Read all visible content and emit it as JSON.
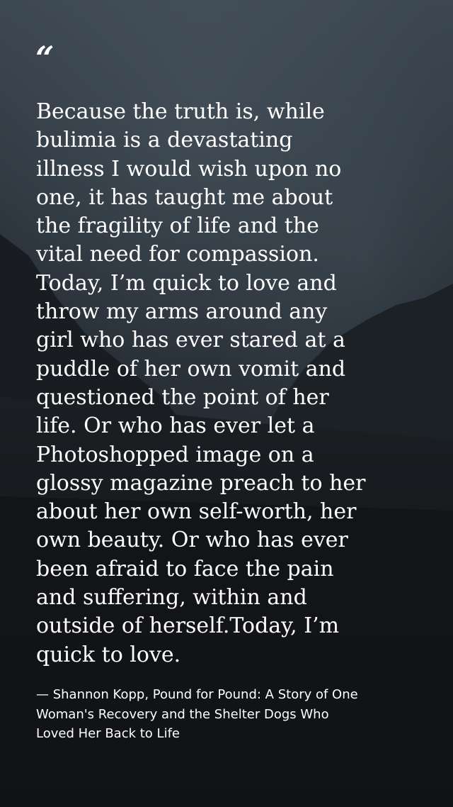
{
  "quote": {
    "mark": "“",
    "text": "Because the truth is, while\nbulimia is a devastating\nillness I would wish upon no\none, it has taught me about\nthe fragility of life and the\nvital need for compassion.\nToday, I’m quick to love and\nthrow my arms around any\ngirl who has ever stared at a\npuddle of her own vomit and\nquestioned the point of her\nlife. Or who has ever let a\nPhotoshopped image on a\nglossy magazine preach to her\nabout her own self-worth, her\nown beauty. Or who has ever\nbeen afraid to face the pain\nand suffering, within and\noutside of herself.Today, I’m\nquick to love.",
    "attribution": "— Shannon Kopp, Pound for Pound: A Story of One\nWoman's Recovery and the Shelter Dogs Who\nLoved Her Back to Life"
  },
  "colors": {
    "text": "#ffffff",
    "background": "#16191d"
  }
}
